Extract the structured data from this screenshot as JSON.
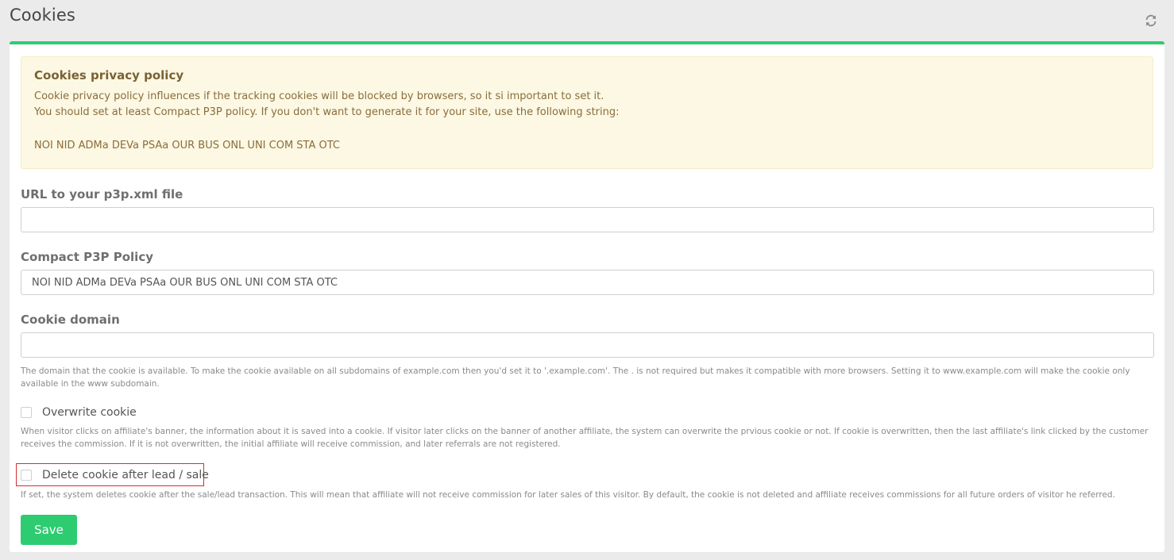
{
  "header": {
    "title": "Cookies",
    "refresh_icon": "refresh-icon"
  },
  "alert": {
    "title": "Cookies privacy policy",
    "line1": "Cookie privacy policy influences if the tracking cookies will be blocked by browsers, so it si important to set it.",
    "line2": "You should set at least Compact P3P policy. If you don't want to generate it for your site, use the following string:",
    "policy_string": "NOI NID ADMa DEVa PSAa OUR BUS ONL UNI COM STA OTC"
  },
  "fields": {
    "p3p_url": {
      "label": "URL to your p3p.xml file",
      "value": ""
    },
    "compact_policy": {
      "label": "Compact P3P Policy",
      "value": "NOI NID ADMa DEVa PSAa OUR BUS ONL UNI COM STA OTC"
    },
    "cookie_domain": {
      "label": "Cookie domain",
      "value": "",
      "help": "The domain that the cookie is available. To make the cookie available on all subdomains of example.com then you'd set it to '.example.com'. The . is not required but makes it compatible with more browsers. Setting it to www.example.com will make the cookie only available in the www subdomain."
    }
  },
  "checkboxes": {
    "overwrite": {
      "label": "Overwrite cookie",
      "checked": false,
      "help": "When visitor clicks on affiliate's banner, the information about it is saved into a cookie. If visitor later clicks on the banner of another affiliate, the system can overwrite the prvious cookie or not. If cookie is overwritten, then the last affiliate's link clicked by the customer receives the commission. If it is not overwritten, the initial affiliate will receive commission, and later referrals are not registered."
    },
    "delete_after": {
      "label": "Delete cookie after lead / sale",
      "checked": false,
      "help": "If set, the system deletes cookie after the sale/lead transaction. This will mean that affiliate will not receive commission for later sales of this visitor. By default, the cookie is not deleted and affiliate receives commissions for all future orders of visitor he referred."
    }
  },
  "actions": {
    "save_label": "Save"
  },
  "colors": {
    "accent": "#2ecc71",
    "alert_bg": "#fcf8e3",
    "alert_text": "#8a6d3b",
    "highlight": "#d2302f"
  }
}
